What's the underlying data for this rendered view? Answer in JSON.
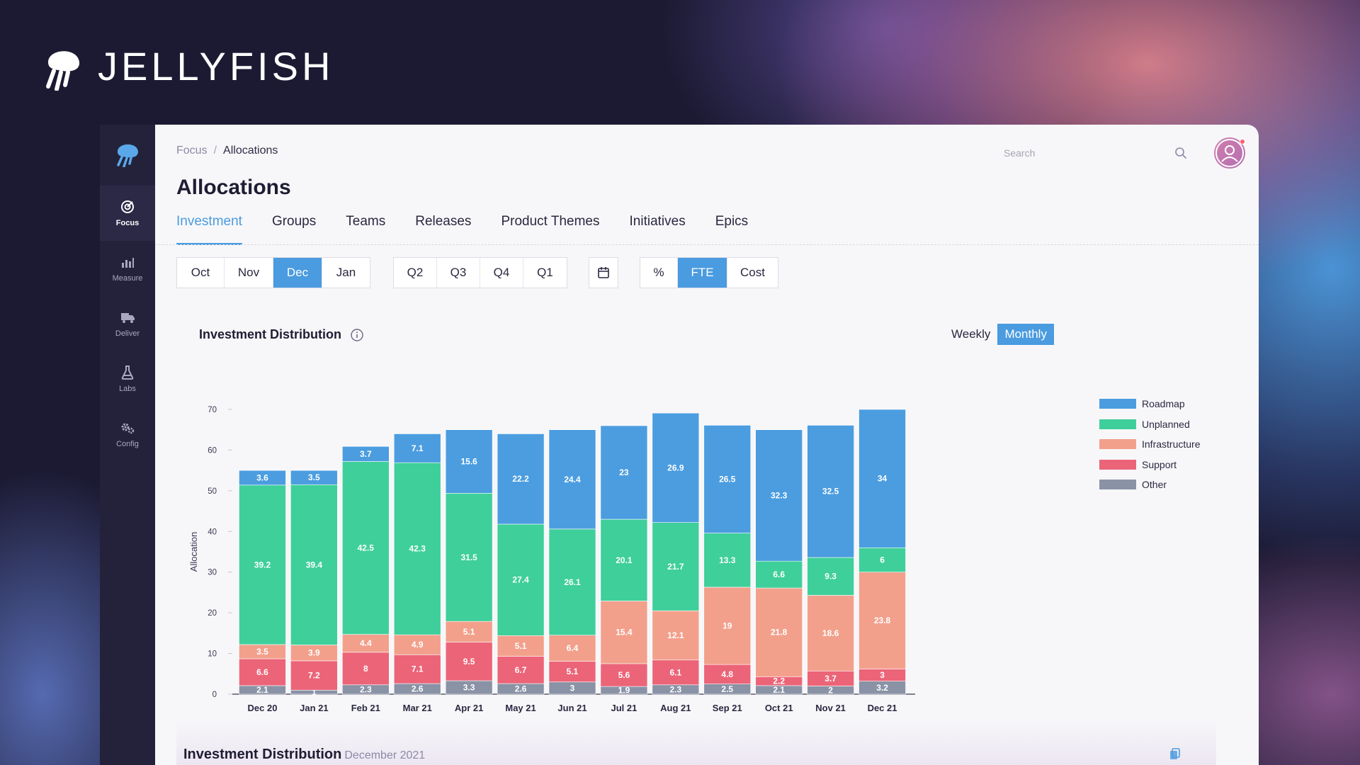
{
  "brand": {
    "name": "JELLYFISH"
  },
  "sidebar": {
    "items": [
      {
        "label": "Focus",
        "icon": "target-icon",
        "active": true
      },
      {
        "label": "Measure",
        "icon": "bar-chart-icon",
        "active": false
      },
      {
        "label": "Deliver",
        "icon": "truck-icon",
        "active": false
      },
      {
        "label": "Labs",
        "icon": "flask-icon",
        "active": false
      },
      {
        "label": "Config",
        "icon": "gears-icon",
        "active": false
      }
    ]
  },
  "breadcrumb": {
    "root": "Focus",
    "separator": "/",
    "current": "Allocations"
  },
  "search": {
    "placeholder": "Search"
  },
  "page": {
    "title": "Allocations"
  },
  "tabs": [
    "Investment",
    "Groups",
    "Teams",
    "Releases",
    "Product Themes",
    "Initiatives",
    "Epics"
  ],
  "active_tab": "Investment",
  "filters": {
    "months": [
      "Oct",
      "Nov",
      "Dec",
      "Jan"
    ],
    "active_month": "Dec",
    "quarters": [
      "Q2",
      "Q3",
      "Q4",
      "Q1"
    ],
    "units": [
      "%",
      "FTE",
      "Cost"
    ],
    "active_unit": "FTE"
  },
  "card": {
    "title": "Investment Distribution"
  },
  "granularity": {
    "options": [
      "Weekly",
      "Monthly"
    ],
    "active": "Monthly"
  },
  "bottom": {
    "title": "Investment Distribution",
    "subtitle": "December 2021"
  },
  "colors": {
    "accent": "#4a9be0",
    "Roadmap": "#4b9de0",
    "Unplanned": "#3fcf9b",
    "Infrastructure": "#f2a08c",
    "Support": "#ec6478",
    "Other": "#8a92a6"
  },
  "chart_data": {
    "type": "bar",
    "stacked": true,
    "ylabel": "Allocation",
    "xlabel": "",
    "ylim": [
      0,
      70
    ],
    "yticks": [
      0,
      10,
      20,
      30,
      40,
      50,
      60,
      70
    ],
    "categories": [
      "Dec 20",
      "Jan 21",
      "Feb 21",
      "Mar 21",
      "Apr 21",
      "May 21",
      "Jun 21",
      "Jul 21",
      "Aug 21",
      "Sep 21",
      "Oct 21",
      "Nov 21",
      "Dec 21"
    ],
    "legend_position": "right",
    "series": [
      {
        "name": "Other",
        "values": [
          2.1,
          1,
          2.3,
          2.6,
          3.3,
          2.6,
          3,
          1.9,
          2.3,
          2.5,
          2.1,
          2,
          3.2
        ]
      },
      {
        "name": "Support",
        "values": [
          6.6,
          7.2,
          8,
          7.1,
          9.5,
          6.7,
          5.1,
          5.6,
          6.1,
          4.8,
          2.2,
          3.7,
          3
        ]
      },
      {
        "name": "Infrastructure",
        "values": [
          3.5,
          3.9,
          4.4,
          4.9,
          5.1,
          5.1,
          6.4,
          15.4,
          12.1,
          19,
          21.8,
          18.6,
          23.8
        ]
      },
      {
        "name": "Unplanned",
        "values": [
          39.2,
          39.4,
          42.5,
          42.3,
          31.5,
          27.4,
          26.1,
          20.1,
          21.7,
          13.3,
          6.6,
          9.3,
          6
        ]
      },
      {
        "name": "Roadmap",
        "values": [
          3.6,
          3.5,
          3.7,
          7.1,
          15.6,
          22.2,
          24.4,
          23,
          26.9,
          26.5,
          32.3,
          32.5,
          34
        ]
      }
    ],
    "legend_order": [
      "Roadmap",
      "Unplanned",
      "Infrastructure",
      "Support",
      "Other"
    ]
  }
}
